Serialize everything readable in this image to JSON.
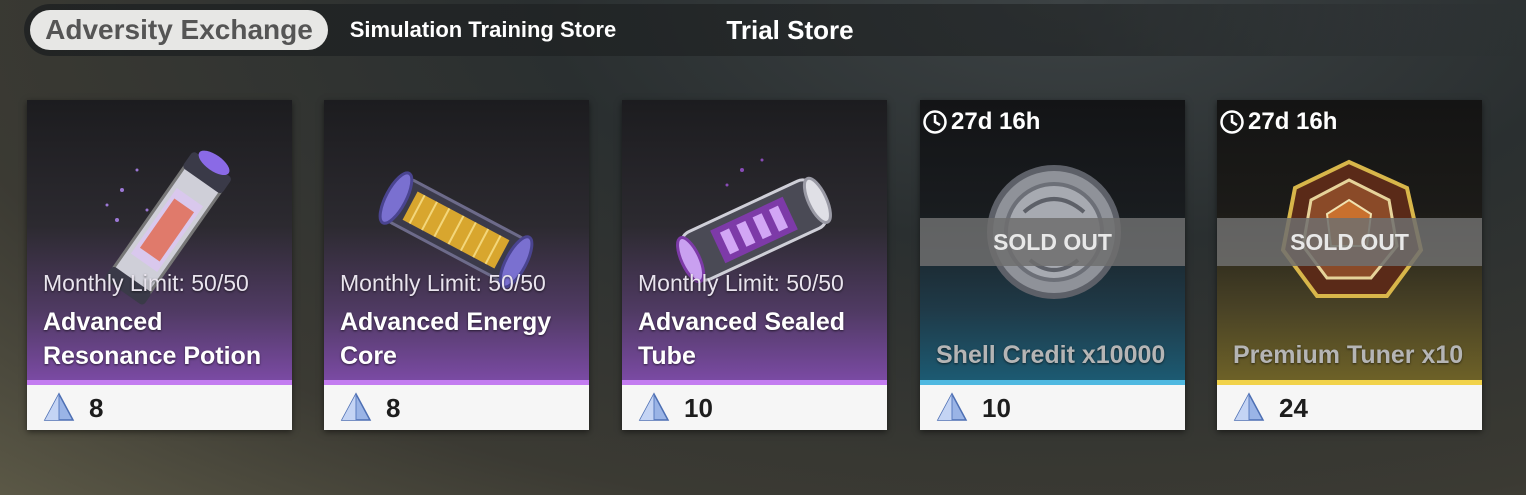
{
  "tabs": [
    {
      "label": "Adversity Exchange",
      "active": true
    },
    {
      "label": "Simulation Training Store",
      "active": false
    },
    {
      "label": "Trial Store",
      "active": false
    }
  ],
  "currency_icon": "crystal-pyramid-icon",
  "items": [
    {
      "name": "Advanced Resonance Potion",
      "limit": "Monthly Limit: 50/50",
      "price": "8",
      "theme": "purple",
      "icon": "resonance-potion-icon"
    },
    {
      "name": "Advanced Energy Core",
      "limit": "Monthly Limit: 50/50",
      "price": "8",
      "theme": "purple",
      "icon": "energy-core-icon"
    },
    {
      "name": "Advanced Sealed Tube",
      "limit": "Monthly Limit: 50/50",
      "price": "10",
      "theme": "purple",
      "icon": "sealed-tube-icon"
    },
    {
      "name": "Shell Credit x10000",
      "timer": "27d 16h",
      "status": "SOLD OUT",
      "price": "10",
      "theme": "blue",
      "icon": "shell-credit-coin-icon"
    },
    {
      "name": "Premium Tuner x10",
      "timer": "27d 16h",
      "status": "SOLD OUT",
      "price": "24",
      "theme": "gold",
      "icon": "premium-tuner-icon"
    }
  ],
  "colors": {
    "purple_accent": "#c37cf0",
    "blue_accent": "#4fb8e0",
    "gold_accent": "#f1d24a",
    "active_tab_bg": "#e7e7e5"
  }
}
